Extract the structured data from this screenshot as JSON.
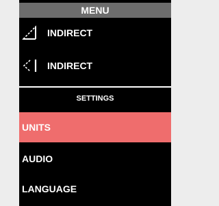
{
  "menu": {
    "title": "MENU",
    "items": [
      {
        "label": "INDIRECT",
        "icon": "ruler-triangle-icon"
      },
      {
        "label": "INDIRECT",
        "icon": "ruler-angle-icon"
      }
    ]
  },
  "settings": {
    "title": "SETTINGS",
    "items": [
      {
        "label": "UNITS",
        "selected": true
      },
      {
        "label": "AUDIO",
        "selected": false
      },
      {
        "label": "LANGUAGE",
        "selected": false
      }
    ]
  },
  "colors": {
    "background": "#000000",
    "header": "#6d6d6d",
    "selected": "#ef6d6d",
    "text": "#ffffff",
    "page": "#ededed"
  }
}
